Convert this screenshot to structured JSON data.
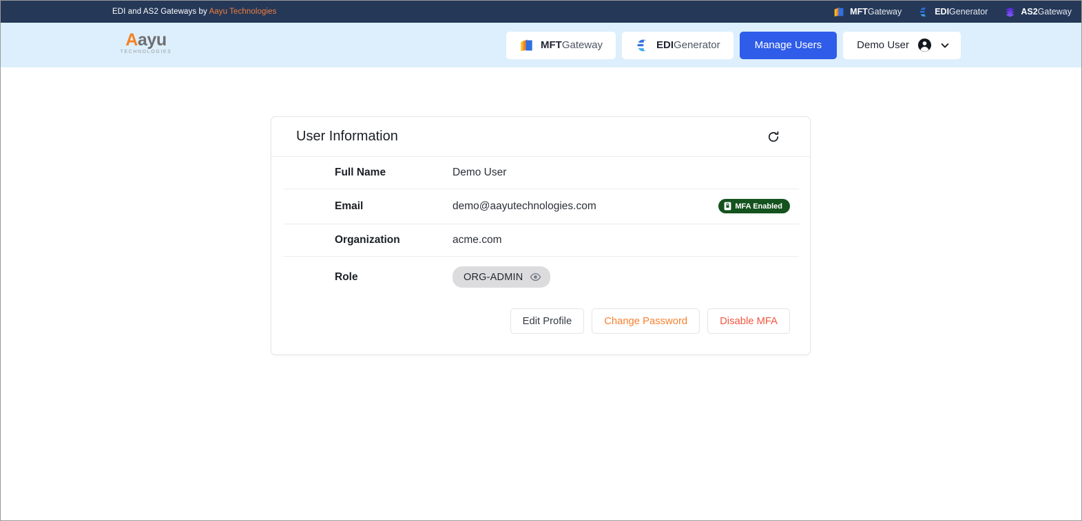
{
  "topbar": {
    "tagline_prefix": "EDI and AS2 Gateways by ",
    "tagline_brand": "Aayu Technologies",
    "links": [
      {
        "strong": "MFT",
        "light": "Gateway",
        "icon": "mft-gateway-icon"
      },
      {
        "strong": "EDI",
        "light": "Generator",
        "icon": "edi-generator-icon"
      },
      {
        "strong": "AS2",
        "light": "Gateway",
        "icon": "as2-gateway-icon"
      }
    ]
  },
  "navbar": {
    "logo": {
      "letter": "A",
      "rest": "ayu",
      "sub": "TECHNOLOGIES"
    },
    "buttons": [
      {
        "strong": "MFT",
        "light": "Gateway",
        "icon": "mft-gateway-icon"
      },
      {
        "strong": "EDI",
        "light": "Generator",
        "icon": "edi-generator-icon"
      }
    ],
    "manage_users_label": "Manage Users",
    "user_name": "Demo User"
  },
  "card": {
    "title": "User Information",
    "rows": [
      {
        "label": "Full Name",
        "value": "Demo User"
      },
      {
        "label": "Email",
        "value": "demo@aayutechnologies.com",
        "badge": "MFA Enabled"
      },
      {
        "label": "Organization",
        "value": "acme.com"
      },
      {
        "label": "Role",
        "value": "ORG-ADMIN"
      }
    ],
    "actions": [
      {
        "label": "Edit Profile",
        "style": "neutral"
      },
      {
        "label": "Change Password",
        "style": "warn"
      },
      {
        "label": "Disable MFA",
        "style": "danger"
      }
    ]
  },
  "colors": {
    "topbar_bg": "#253858",
    "navbar_bg": "#ddeffc",
    "brand_orange": "#f58220",
    "primary_blue": "#2f5ce8",
    "mfa_green": "#14521e",
    "danger_red": "#f4553f"
  }
}
